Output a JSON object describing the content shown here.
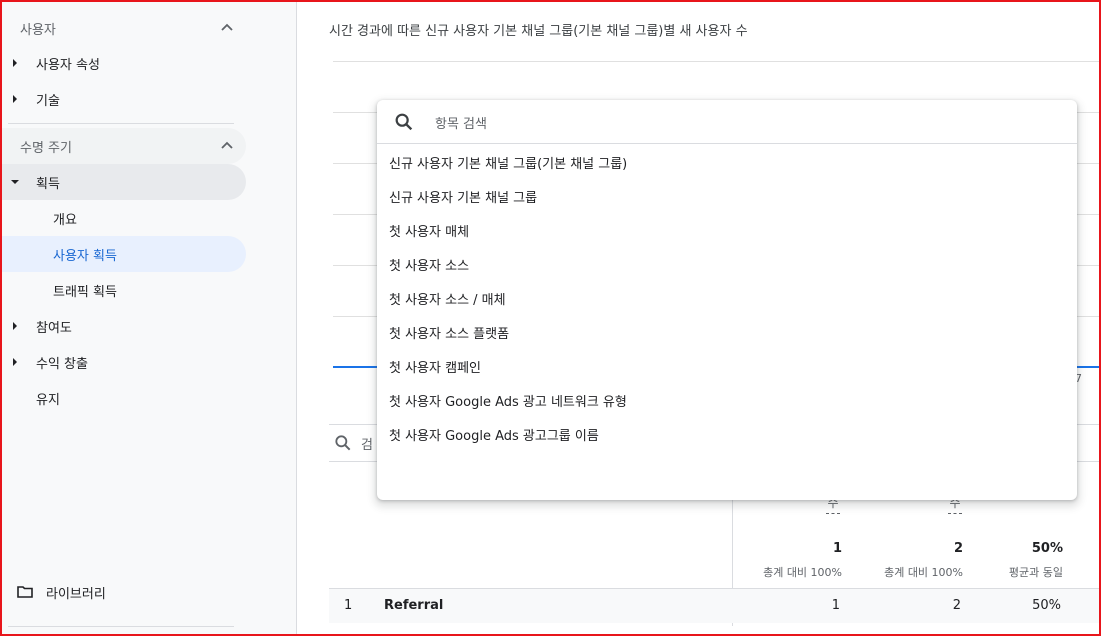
{
  "sidebar": {
    "sections": [
      {
        "label": "사용자"
      },
      {
        "label": "수명 주기"
      }
    ],
    "users_items": [
      {
        "label": "사용자 속성"
      },
      {
        "label": "기술"
      }
    ],
    "lifecycle_items": [
      {
        "label": "획득"
      },
      {
        "label": "개요"
      },
      {
        "label": "사용자 획득"
      },
      {
        "label": "트래픽 획득"
      },
      {
        "label": "참여도"
      },
      {
        "label": "수익 창출"
      },
      {
        "label": "유지"
      }
    ],
    "library_label": "라이브러리"
  },
  "main": {
    "chart_title": "시간 경과에 따른 신규 사용자 기본 채널 그룹(기본 채널 그룹)별 새 사용자 수",
    "axis_tick": "7",
    "table_search_placeholder": "검",
    "columns": [
      {
        "label": "수"
      },
      {
        "label": "수"
      }
    ],
    "totals": [
      {
        "value": "1",
        "sub": "총계 대비 100%"
      },
      {
        "value": "2",
        "sub": "총계 대비 100%"
      },
      {
        "value": "50%",
        "sub": "평균과 동일"
      }
    ],
    "row": {
      "index": "1",
      "channel": "Referral",
      "values": [
        "1",
        "2",
        "50%"
      ]
    }
  },
  "dropdown": {
    "search_placeholder": "항목 검색",
    "items": [
      "신규 사용자 기본 채널 그룹(기본 채널 그룹)",
      "신규 사용자 기본 채널 그룹",
      "첫 사용자 매체",
      "첫 사용자 소스",
      "첫 사용자 소스 / 매체",
      "첫 사용자 소스 플랫폼",
      "첫 사용자 캠페인",
      "첫 사용자 Google Ads 광고 네트워크 유형",
      "첫 사용자 Google Ads 광고그룹 이름"
    ]
  },
  "colors": {
    "accent": "#1a73e8",
    "active_bg": "#e8f0fe",
    "active_text": "#1967d2",
    "frame": "#e8151b"
  },
  "icons": [
    "chevron-up-icon",
    "caret-right-icon",
    "caret-down-icon",
    "folder-icon",
    "search-icon"
  ]
}
